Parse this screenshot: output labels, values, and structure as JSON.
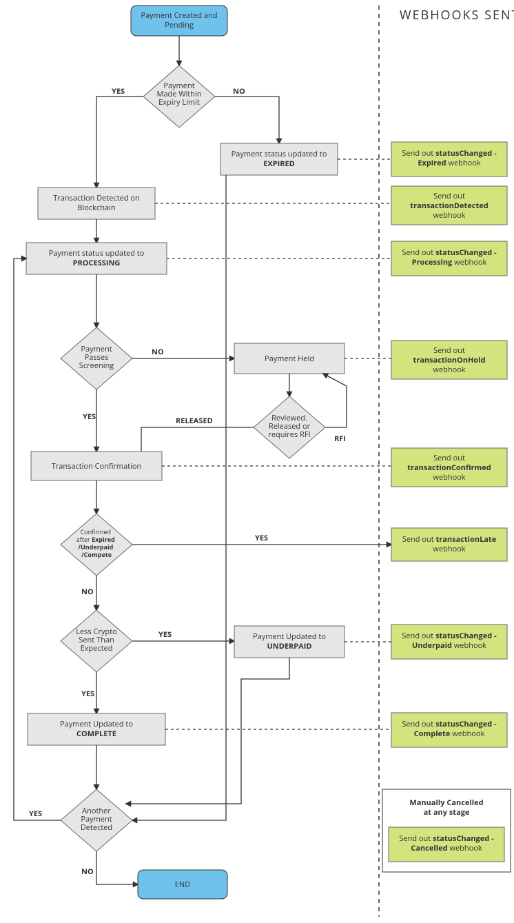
{
  "heading": "WEBHOOKS SENT",
  "colors": {
    "start": "#6fc2ec",
    "process": "#e6e6e6",
    "webhook": "#d5e37f"
  },
  "nodes": {
    "start": {
      "l1": "Payment Created and",
      "l2": "Pending"
    },
    "d_expiry": {
      "l1": "Payment",
      "l2": "Made Within",
      "l3": "Expiry Limit"
    },
    "expired": {
      "l1": "Payment status updated to",
      "l2": "EXPIRED"
    },
    "detected": {
      "l1": "Transaction Detected on",
      "l2": "Blockchain"
    },
    "processing": {
      "l1": "Payment status updated to",
      "l2": "PROCESSING"
    },
    "d_screen": {
      "l1": "Payment",
      "l2": "Passes",
      "l3": "Screening"
    },
    "held": {
      "l1": "Payment Held"
    },
    "d_review": {
      "l1": "Reviewed.",
      "l2": "Released or",
      "l3": "requires RFI"
    },
    "confirm": {
      "l1": "Transaction Confirmation"
    },
    "d_late": {
      "l1": "Confirmed",
      "l2a": "after ",
      "l2b": "Expired",
      "l3": "/Underpaid",
      "l4": "/Compete"
    },
    "d_under": {
      "l1": "Less Crypto",
      "l2": "Sent Than",
      "l3": "Expected"
    },
    "underpaid": {
      "l1": "Payment Updated to",
      "l2": "UNDERPAID"
    },
    "complete": {
      "l1": "Payment Updated to",
      "l2": "COMPLETE"
    },
    "d_another": {
      "l1": "Another",
      "l2": "Payment",
      "l3": "Detected"
    },
    "end": {
      "l1": "END"
    }
  },
  "labels": {
    "yes": "YES",
    "no": "NO",
    "released": "RELEASED",
    "rfi": "RFI"
  },
  "webhooks": {
    "expired": {
      "a": "Send out ",
      "b": "statusChanged -",
      "c": "Expired",
      "d": " webhook"
    },
    "detected": {
      "a": "Send out",
      "b": "transactionDetected",
      "c": "webhook"
    },
    "processing": {
      "a": "Send out ",
      "b": "statusChanged -",
      "c": "Processing",
      "d": " webhook"
    },
    "onhold": {
      "a": "Send out",
      "b": "transactionOnHold",
      "c": "webhook"
    },
    "confirmed": {
      "a": "Send out",
      "b": "transactionConfirmed",
      "c": "webhook"
    },
    "late": {
      "a": "Send out ",
      "b": "transactionLate",
      "c": "webhook"
    },
    "underpaid": {
      "a": "Send out ",
      "b": "statusChanged -",
      "c": "Underpaid",
      "d": " webhook"
    },
    "complete": {
      "a": "Send out ",
      "b": "statusChanged -",
      "c": "Complete",
      "d": " webhook"
    },
    "cancelled": {
      "a": "Send out ",
      "b": "statusChanged -",
      "c": "Cancelled",
      "d": " webhook"
    }
  },
  "manual": {
    "l1": "Manually Cancelled",
    "l2": "at any stage"
  }
}
